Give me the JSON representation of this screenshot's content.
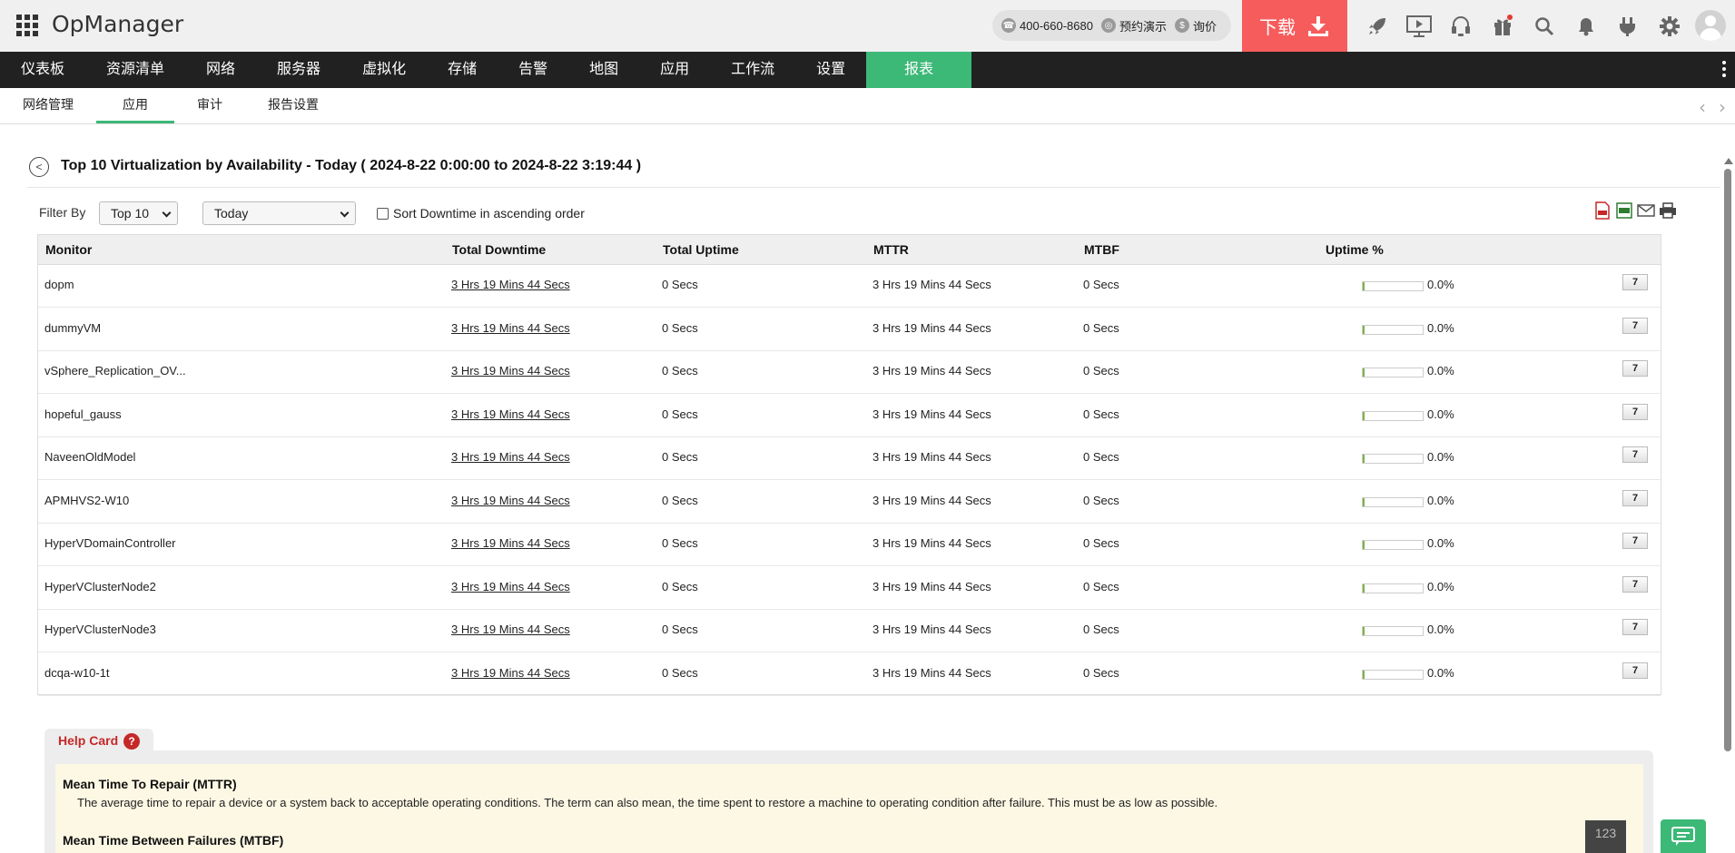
{
  "app": {
    "title": "OpManager"
  },
  "contact": {
    "phone": "400-660-8680",
    "demo": "预约演示",
    "price": "询价"
  },
  "download": {
    "label": "下载"
  },
  "toolbar_icons": [
    "rocket-icon",
    "presentation-icon",
    "headset-icon",
    "gift-icon",
    "search-icon",
    "bell-icon",
    "plug-icon",
    "gear-icon",
    "user-avatar"
  ],
  "main_nav": [
    "仪表板",
    "资源清单",
    "网络",
    "服务器",
    "虚拟化",
    "存储",
    "告警",
    "地图",
    "应用",
    "工作流",
    "设置",
    "报表"
  ],
  "main_nav_active": "报表",
  "sub_nav": [
    "网络管理",
    "应用",
    "审计",
    "报告设置"
  ],
  "sub_nav_active": "应用",
  "report": {
    "title": "Top 10 Virtualization by Availability - Today ( 2024-8-22 0:00:00 to 2024-8-22 3:19:44 )"
  },
  "filter": {
    "label": "Filter By",
    "top": "Top 10",
    "period": "Today",
    "sort_label": "Sort Downtime in ascending order",
    "sort_checked": false
  },
  "export_icons": [
    "pdf-icon",
    "csv-icon",
    "email-icon",
    "print-icon"
  ],
  "table": {
    "columns": [
      "Monitor",
      "Total Downtime",
      "Total Uptime",
      "MTTR",
      "MTBF",
      "Uptime %"
    ],
    "rows": [
      {
        "monitor": "dopm",
        "downtime": "3 Hrs 19 Mins 44 Secs",
        "uptime": "0 Secs",
        "mttr": "3 Hrs 19 Mins 44 Secs",
        "mtbf": "0 Secs",
        "uptime_pct": "0.0%",
        "btn": "7"
      },
      {
        "monitor": "dummyVM",
        "downtime": "3 Hrs 19 Mins 44 Secs",
        "uptime": "0 Secs",
        "mttr": "3 Hrs 19 Mins 44 Secs",
        "mtbf": "0 Secs",
        "uptime_pct": "0.0%",
        "btn": "7"
      },
      {
        "monitor": "vSphere_Replication_OV...",
        "downtime": "3 Hrs 19 Mins 44 Secs",
        "uptime": "0 Secs",
        "mttr": "3 Hrs 19 Mins 44 Secs",
        "mtbf": "0 Secs",
        "uptime_pct": "0.0%",
        "btn": "7"
      },
      {
        "monitor": "hopeful_gauss",
        "downtime": "3 Hrs 19 Mins 44 Secs",
        "uptime": "0 Secs",
        "mttr": "3 Hrs 19 Mins 44 Secs",
        "mtbf": "0 Secs",
        "uptime_pct": "0.0%",
        "btn": "7"
      },
      {
        "monitor": "NaveenOldModel",
        "downtime": "3 Hrs 19 Mins 44 Secs",
        "uptime": "0 Secs",
        "mttr": "3 Hrs 19 Mins 44 Secs",
        "mtbf": "0 Secs",
        "uptime_pct": "0.0%",
        "btn": "7"
      },
      {
        "monitor": "APMHVS2-W10",
        "downtime": "3 Hrs 19 Mins 44 Secs",
        "uptime": "0 Secs",
        "mttr": "3 Hrs 19 Mins 44 Secs",
        "mtbf": "0 Secs",
        "uptime_pct": "0.0%",
        "btn": "7"
      },
      {
        "monitor": "HyperVDomainController",
        "downtime": "3 Hrs 19 Mins 44 Secs",
        "uptime": "0 Secs",
        "mttr": "3 Hrs 19 Mins 44 Secs",
        "mtbf": "0 Secs",
        "uptime_pct": "0.0%",
        "btn": "7"
      },
      {
        "monitor": "HyperVClusterNode2",
        "downtime": "3 Hrs 19 Mins 44 Secs",
        "uptime": "0 Secs",
        "mttr": "3 Hrs 19 Mins 44 Secs",
        "mtbf": "0 Secs",
        "uptime_pct": "0.0%",
        "btn": "7"
      },
      {
        "monitor": "HyperVClusterNode3",
        "downtime": "3 Hrs 19 Mins 44 Secs",
        "uptime": "0 Secs",
        "mttr": "3 Hrs 19 Mins 44 Secs",
        "mtbf": "0 Secs",
        "uptime_pct": "0.0%",
        "btn": "7"
      },
      {
        "monitor": "dcqa-w10-1t",
        "downtime": "3 Hrs 19 Mins 44 Secs",
        "uptime": "0 Secs",
        "mttr": "3 Hrs 19 Mins 44 Secs",
        "mtbf": "0 Secs",
        "uptime_pct": "0.0%",
        "btn": "7"
      }
    ]
  },
  "help": {
    "tab_label": "Help Card",
    "q": "?",
    "mttr_title": "Mean Time To Repair (MTTR)",
    "mttr_desc": "The average time to repair a device or a system back to acceptable operating conditions. The term can also mean, the time spent to restore a machine to operating condition after failure. This must be as low as possible.",
    "mtbf_title": "Mean Time Between Failures (MTBF)",
    "badge": "123"
  },
  "colors": {
    "accent": "#3cb877",
    "download": "#f75c5c",
    "nav_bg": "#212121",
    "help_red": "#c62828"
  }
}
